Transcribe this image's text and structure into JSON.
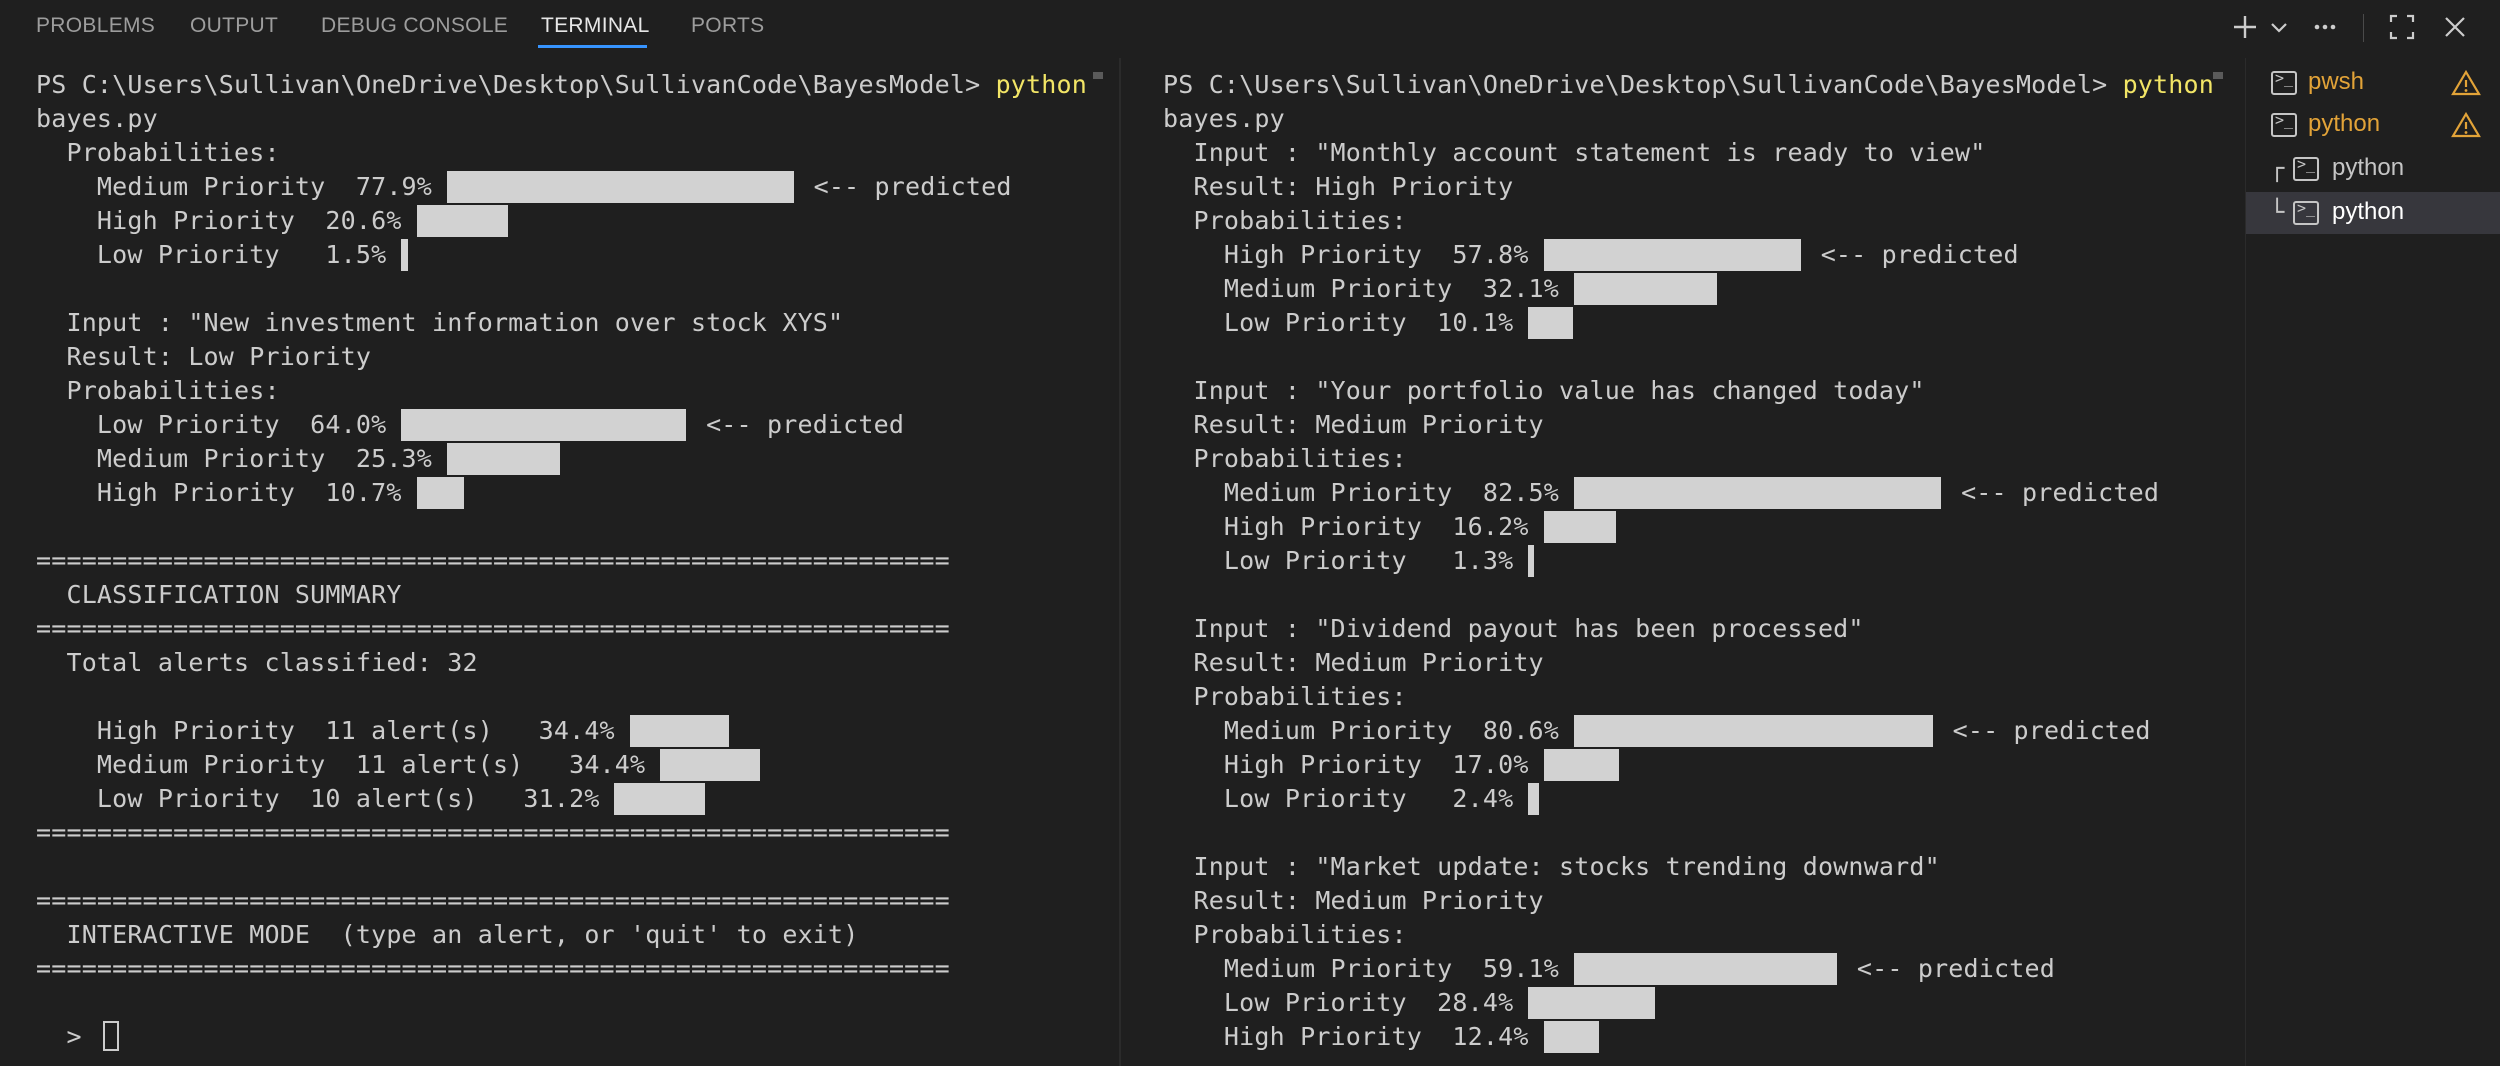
{
  "tabs": [
    {
      "label": "PROBLEMS"
    },
    {
      "label": "OUTPUT"
    },
    {
      "label": "DEBUG CONSOLE"
    },
    {
      "label": "TERMINAL",
      "active": true
    },
    {
      "label": "PORTS"
    }
  ],
  "toolbar_icons": [
    "plus-icon",
    "chevron-down-icon",
    "more-icon",
    "maximize-icon",
    "close-icon"
  ],
  "colors": {
    "accent": "#3794ff",
    "command": "#f2e566",
    "warning": "#e2a338",
    "bar": "#d2d2d2"
  },
  "left_terminal": {
    "lines": [
      {
        "segments": [
          {
            "text": "PS C:\\Users\\Sullivan\\OneDrive\\Desktop\\SullivanCode\\BayesModel> "
          },
          {
            "text": "python",
            "cls": "cmd"
          }
        ]
      },
      {
        "text": "bayes.py"
      },
      {
        "text": "  Probabilities:"
      },
      {
        "text": "    Medium Priority  77.9%",
        "bar": 0.779,
        "note": "<-- predicted"
      },
      {
        "text": "    High Priority  20.6%",
        "bar": 0.206
      },
      {
        "text": "    Low Priority   1.5%",
        "bar": 0.015
      },
      {
        "text": ""
      },
      {
        "text": "  Input : \"New investment information over stock XYS\""
      },
      {
        "text": "  Result: Low Priority"
      },
      {
        "text": "  Probabilities:"
      },
      {
        "text": "    Low Priority  64.0%",
        "bar": 0.64,
        "note": "<-- predicted"
      },
      {
        "text": "    Medium Priority  25.3%",
        "bar": 0.253
      },
      {
        "text": "    High Priority  10.7%",
        "bar": 0.107
      },
      {
        "text": ""
      },
      {
        "text": "============================================================"
      },
      {
        "text": "  CLASSIFICATION SUMMARY"
      },
      {
        "text": "============================================================"
      },
      {
        "text": "  Total alerts classified: 32"
      },
      {
        "text": ""
      },
      {
        "text": "    High Priority  11 alert(s)   34.4%",
        "bar": 0.344,
        "barScale": 290
      },
      {
        "text": "    Medium Priority  11 alert(s)   34.4%",
        "bar": 0.344,
        "barScale": 290
      },
      {
        "text": "    Low Priority  10 alert(s)   31.2%",
        "bar": 0.312,
        "barScale": 290
      },
      {
        "text": "============================================================"
      },
      {
        "text": ""
      },
      {
        "text": "============================================================"
      },
      {
        "text": "  INTERACTIVE MODE  (type an alert, or 'quit' to exit)"
      },
      {
        "text": "============================================================"
      },
      {
        "text": ""
      },
      {
        "text": "  > ",
        "cursor": true
      }
    ]
  },
  "right_terminal": {
    "lines": [
      {
        "segments": [
          {
            "text": "PS C:\\Users\\Sullivan\\OneDrive\\Desktop\\SullivanCode\\BayesModel> "
          },
          {
            "text": "python",
            "cls": "cmd"
          }
        ]
      },
      {
        "text": "bayes.py"
      },
      {
        "text": "  Input : \"Monthly account statement is ready to view\""
      },
      {
        "text": "  Result: High Priority"
      },
      {
        "text": "  Probabilities:"
      },
      {
        "text": "    High Priority  57.8%",
        "bar": 0.578,
        "note": "<-- predicted"
      },
      {
        "text": "    Medium Priority  32.1%",
        "bar": 0.321
      },
      {
        "text": "    Low Priority  10.1%",
        "bar": 0.101
      },
      {
        "text": ""
      },
      {
        "text": "  Input : \"Your portfolio value has changed today\""
      },
      {
        "text": "  Result: Medium Priority"
      },
      {
        "text": "  Probabilities:"
      },
      {
        "text": "    Medium Priority  82.5%",
        "bar": 0.825,
        "note": "<-- predicted"
      },
      {
        "text": "    High Priority  16.2%",
        "bar": 0.162
      },
      {
        "text": "    Low Priority   1.3%",
        "bar": 0.013
      },
      {
        "text": ""
      },
      {
        "text": "  Input : \"Dividend payout has been processed\""
      },
      {
        "text": "  Result: Medium Priority"
      },
      {
        "text": "  Probabilities:"
      },
      {
        "text": "    Medium Priority  80.6%",
        "bar": 0.806,
        "note": "<-- predicted"
      },
      {
        "text": "    High Priority  17.0%",
        "bar": 0.17
      },
      {
        "text": "    Low Priority   2.4%",
        "bar": 0.024
      },
      {
        "text": ""
      },
      {
        "text": "  Input : \"Market update: stocks trending downward\""
      },
      {
        "text": "  Result: Medium Priority"
      },
      {
        "text": "  Probabilities:"
      },
      {
        "text": "    Medium Priority  59.1%",
        "bar": 0.591,
        "note": "<-- predicted"
      },
      {
        "text": "    Low Priority  28.4%",
        "bar": 0.284
      },
      {
        "text": "    High Priority  12.4%",
        "bar": 0.124
      }
    ]
  },
  "sidebar": {
    "items": [
      {
        "label": "pwsh",
        "warning": true,
        "color": "#e2a338"
      },
      {
        "label": "python",
        "warning": true,
        "color": "#e2a338"
      },
      {
        "label": "python",
        "tree": "┌",
        "color": "#c5c5c5"
      },
      {
        "label": "python",
        "tree": "└",
        "color": "#ffffff",
        "selected": true
      }
    ]
  }
}
